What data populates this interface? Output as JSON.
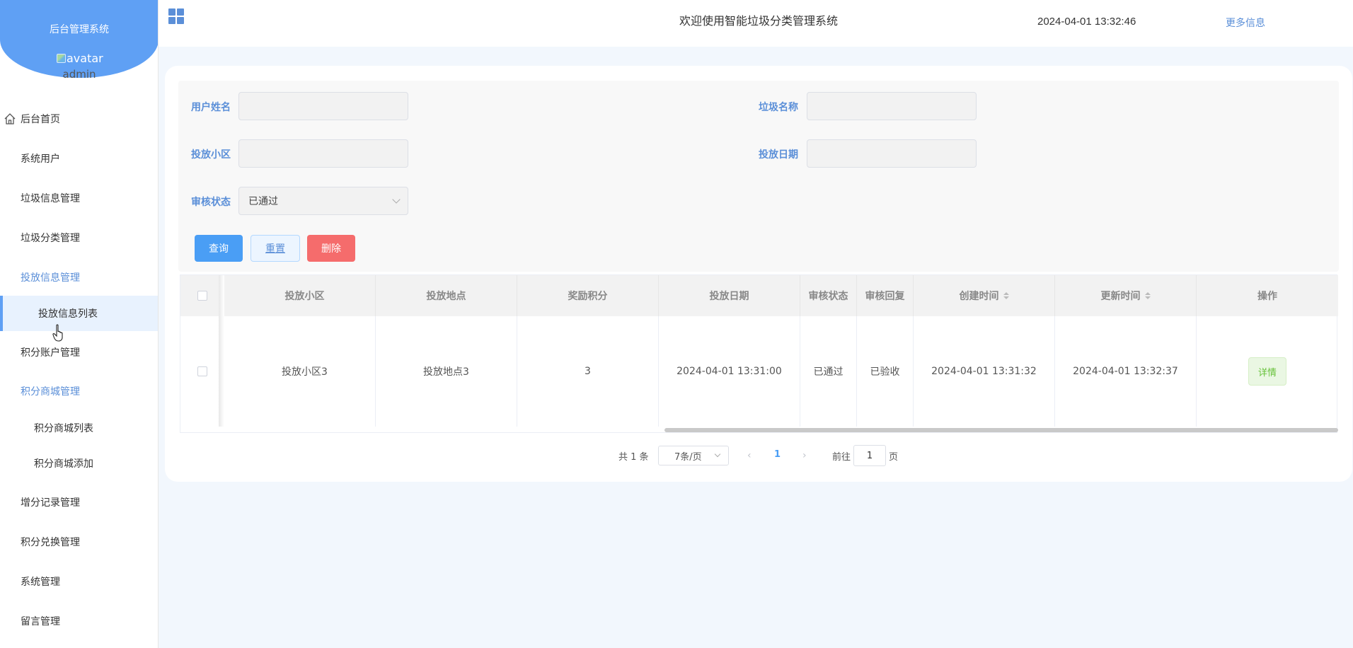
{
  "sidebar": {
    "brand_title": "后台管理系统",
    "avatar_alt": "avatar",
    "username": "admin",
    "items": [
      {
        "label": "后台首页"
      },
      {
        "label": "系统用户"
      },
      {
        "label": "垃圾信息管理"
      },
      {
        "label": "垃圾分类管理"
      },
      {
        "label": "投放信息管理"
      },
      {
        "label": "投放信息列表"
      },
      {
        "label": "积分账户管理"
      },
      {
        "label": "积分商城管理"
      },
      {
        "label": "积分商城列表"
      },
      {
        "label": "积分商城添加"
      },
      {
        "label": "增分记录管理"
      },
      {
        "label": "积分兑换管理"
      },
      {
        "label": "系统管理"
      },
      {
        "label": "留言管理"
      }
    ]
  },
  "header": {
    "title": "欢迎使用智能垃圾分类管理系统",
    "datetime": "2024-04-01 13:32:46",
    "more_label": "更多信息"
  },
  "search": {
    "user_name_label": "用户姓名",
    "user_name_value": "",
    "garbage_name_label": "垃圾名称",
    "garbage_name_value": "",
    "community_label": "投放小区",
    "community_value": "",
    "date_label": "投放日期",
    "date_value": "",
    "status_label": "审核状态",
    "status_value": "已通过",
    "query_label": "查询",
    "reset_label": "重置",
    "delete_label": "删除"
  },
  "table": {
    "columns": [
      "投放小区",
      "投放地点",
      "奖励积分",
      "投放日期",
      "审核状态",
      "审核回复",
      "创建时间",
      "更新时间",
      "操作"
    ],
    "rows": [
      {
        "community": "投放小区3",
        "location": "投放地点3",
        "points": "3",
        "date": "2024-04-01 13:31:00",
        "status": "已通过",
        "reply": "已验收",
        "created": "2024-04-01 13:31:32",
        "updated": "2024-04-01 13:32:37",
        "action": "详情"
      }
    ]
  },
  "pagination": {
    "total": "共 1 条",
    "page_size": "7条/页",
    "current_page": "1",
    "goto_label": "前往",
    "goto_value": "1",
    "page_suffix": "页"
  },
  "colors": {
    "accent": "#5fa0f4",
    "primary_button": "#4a9ef5",
    "danger_button": "#f56c6c",
    "success_text": "#67c23a"
  }
}
